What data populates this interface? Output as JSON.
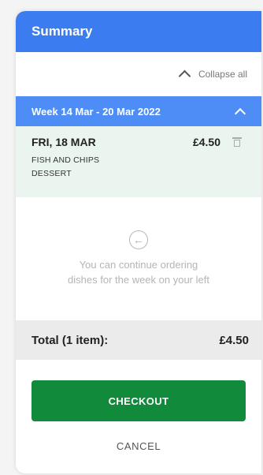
{
  "header": {
    "title": "Summary"
  },
  "collapse": {
    "label": "Collapse all",
    "icon": "chevron-up-icon"
  },
  "week": {
    "label": "Week 14 Mar - 20 Mar 2022",
    "icon": "chevron-up-icon"
  },
  "order": {
    "date": "FRI, 18 MAR",
    "price": "£4.50",
    "dishes": [
      "FISH AND CHIPS",
      "DESSERT"
    ],
    "delete_icon": "trash-icon"
  },
  "continue_message": {
    "icon": "arrow-left-circle-icon",
    "line1": "You can continue ordering",
    "line2": "dishes for the week on your left"
  },
  "total": {
    "label": "Total (1 item):",
    "amount": "£4.50"
  },
  "actions": {
    "checkout_label": "CHECKOUT",
    "cancel_label": "CANCEL"
  },
  "colors": {
    "header_blue": "#3b7cf0",
    "week_blue": "#4d8df5",
    "order_bg": "#eaf5f0",
    "checkout_green": "#128a3c"
  }
}
